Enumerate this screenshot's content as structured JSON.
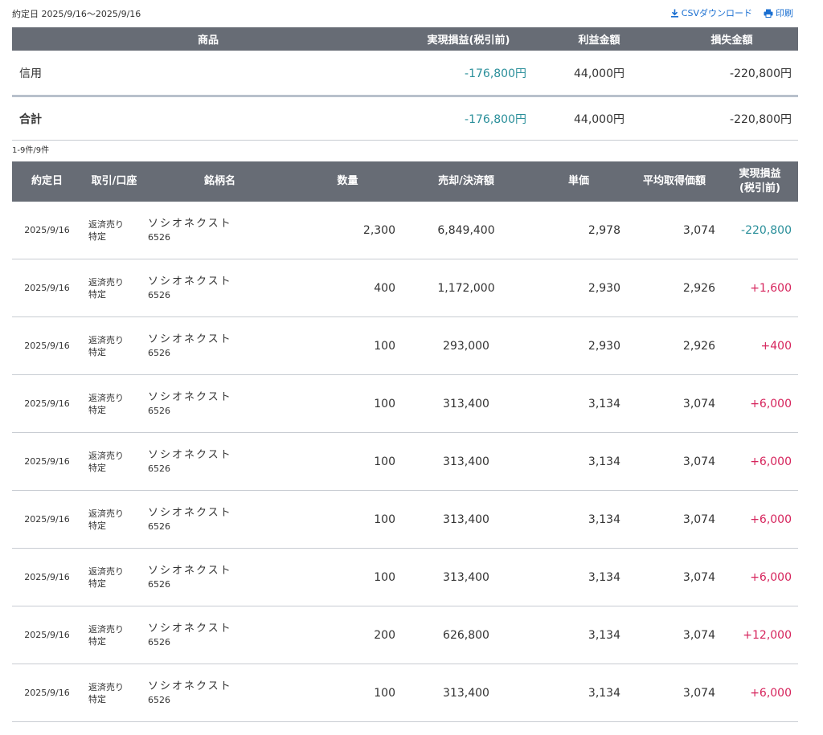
{
  "header": {
    "date_range": "約定日 2025/9/16〜2025/9/16",
    "csv_label": "CSVダウンロード",
    "print_label": "印刷",
    "csv_icon": "download-icon",
    "print_icon": "printer-icon"
  },
  "summary": {
    "columns": [
      "商品",
      "実現損益(税引前)",
      "利益金額",
      "損失金額"
    ],
    "rows": [
      {
        "label": "信用",
        "realized": "-176,800円",
        "profit": "44,000円",
        "loss": "-220,800円"
      },
      {
        "label": "合計",
        "realized": "-176,800円",
        "profit": "44,000円",
        "loss": "-220,800円"
      }
    ]
  },
  "count_text": "1-9件/9件",
  "detail": {
    "columns": [
      "約定日",
      "取引/口座",
      "銘柄名",
      "数量",
      "売却/決済額",
      "単価",
      "平均取得価額",
      "実現損益\n(税引前)"
    ],
    "rows": [
      {
        "date": "2025/9/16",
        "trade": "返済売り",
        "account": "特定",
        "name": "ソシオネクスト",
        "code": "6526",
        "qty": "2,300",
        "amount": "6,849,400",
        "price": "2,978",
        "avg": "3,074",
        "pl": "-220,800",
        "pl_sign": "neg"
      },
      {
        "date": "2025/9/16",
        "trade": "返済売り",
        "account": "特定",
        "name": "ソシオネクスト",
        "code": "6526",
        "qty": "400",
        "amount": "1,172,000",
        "price": "2,930",
        "avg": "2,926",
        "pl": "+1,600",
        "pl_sign": "pos"
      },
      {
        "date": "2025/9/16",
        "trade": "返済売り",
        "account": "特定",
        "name": "ソシオネクスト",
        "code": "6526",
        "qty": "100",
        "amount": "293,000",
        "price": "2,930",
        "avg": "2,926",
        "pl": "+400",
        "pl_sign": "pos"
      },
      {
        "date": "2025/9/16",
        "trade": "返済売り",
        "account": "特定",
        "name": "ソシオネクスト",
        "code": "6526",
        "qty": "100",
        "amount": "313,400",
        "price": "3,134",
        "avg": "3,074",
        "pl": "+6,000",
        "pl_sign": "pos"
      },
      {
        "date": "2025/9/16",
        "trade": "返済売り",
        "account": "特定",
        "name": "ソシオネクスト",
        "code": "6526",
        "qty": "100",
        "amount": "313,400",
        "price": "3,134",
        "avg": "3,074",
        "pl": "+6,000",
        "pl_sign": "pos"
      },
      {
        "date": "2025/9/16",
        "trade": "返済売り",
        "account": "特定",
        "name": "ソシオネクスト",
        "code": "6526",
        "qty": "100",
        "amount": "313,400",
        "price": "3,134",
        "avg": "3,074",
        "pl": "+6,000",
        "pl_sign": "pos"
      },
      {
        "date": "2025/9/16",
        "trade": "返済売り",
        "account": "特定",
        "name": "ソシオネクスト",
        "code": "6526",
        "qty": "100",
        "amount": "313,400",
        "price": "3,134",
        "avg": "3,074",
        "pl": "+6,000",
        "pl_sign": "pos"
      },
      {
        "date": "2025/9/16",
        "trade": "返済売り",
        "account": "特定",
        "name": "ソシオネクスト",
        "code": "6526",
        "qty": "200",
        "amount": "626,800",
        "price": "3,134",
        "avg": "3,074",
        "pl": "+12,000",
        "pl_sign": "pos"
      },
      {
        "date": "2025/9/16",
        "trade": "返済売り",
        "account": "特定",
        "name": "ソシオネクスト",
        "code": "6526",
        "qty": "100",
        "amount": "313,400",
        "price": "3,134",
        "avg": "3,074",
        "pl": "+6,000",
        "pl_sign": "pos"
      }
    ]
  },
  "colors": {
    "header_bg": "#676c75",
    "link": "#1a6fd1",
    "loss": "#2a8f9a",
    "gain": "#d6245c"
  }
}
